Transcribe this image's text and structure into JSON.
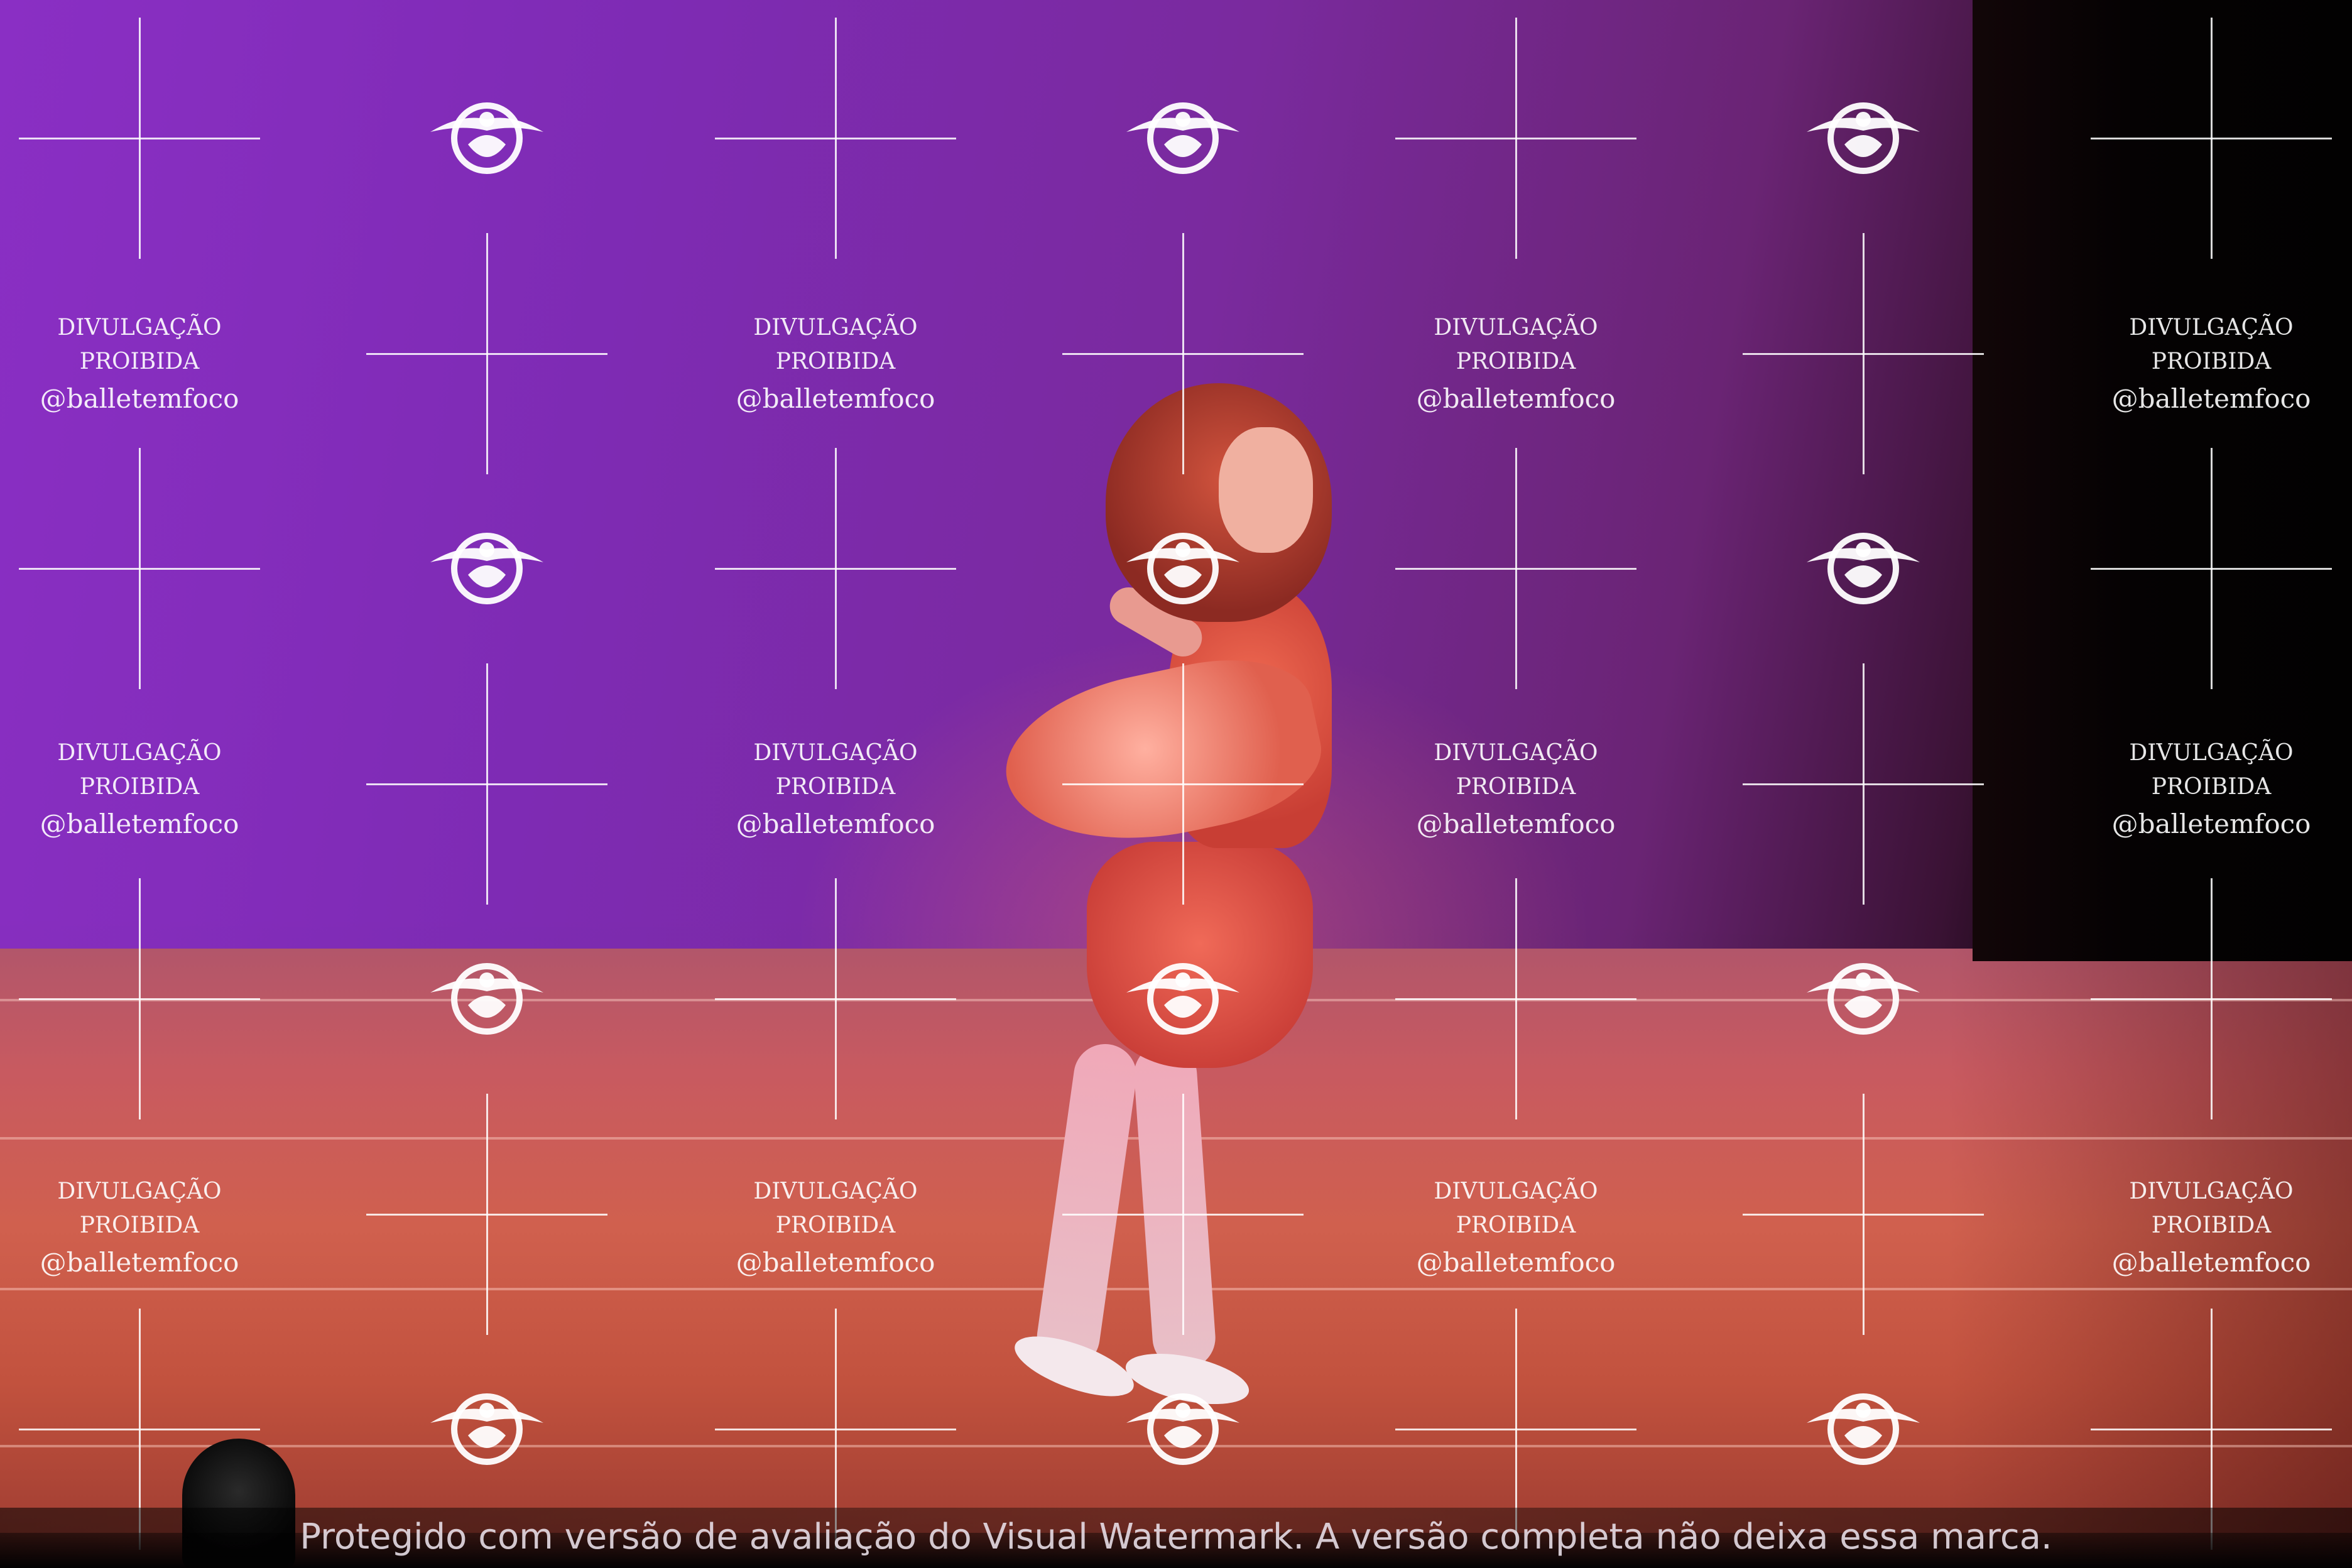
{
  "scene": {
    "description_colors": {
      "backdrop": "#7e2bb4",
      "floor": "#c85a60",
      "curtain": "#050203",
      "dress": "#e0604e"
    }
  },
  "watermark": {
    "line1": "DIVULGAÇÃO PROIBIDA",
    "line2": "@balletemfoco"
  },
  "footer": {
    "text": "Protegido com versão de avaliação do Visual Watermark. A versão completa não deixa essa marca."
  }
}
